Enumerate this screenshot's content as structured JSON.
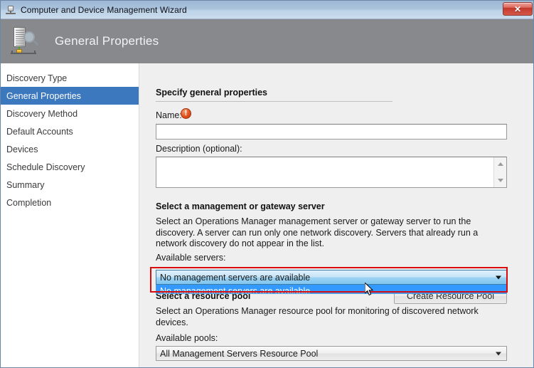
{
  "window": {
    "title": "Computer and Device Management Wizard",
    "title_icon": "device-icon",
    "close_label": "✕"
  },
  "header": {
    "title": "General Properties",
    "icon": "network-discovery-icon"
  },
  "sidebar": {
    "items": [
      {
        "label": "Discovery Type",
        "selected": false
      },
      {
        "label": "General Properties",
        "selected": true
      },
      {
        "label": "Discovery Method",
        "selected": false
      },
      {
        "label": "Default Accounts",
        "selected": false
      },
      {
        "label": "Devices",
        "selected": false
      },
      {
        "label": "Schedule Discovery",
        "selected": false
      },
      {
        "label": "Summary",
        "selected": false
      },
      {
        "label": "Completion",
        "selected": false
      }
    ]
  },
  "main": {
    "general_section": {
      "title": "Specify general properties",
      "name_label": "Name:",
      "name_warning_icon": "error-exclamation-icon",
      "name_warning_glyph": "!",
      "name_value": "",
      "name_placeholder": "",
      "description_label": "Description (optional):",
      "description_value": "",
      "description_placeholder": "",
      "scrollbar_up_icon": "scroll-up-arrow-icon",
      "scrollbar_down_icon": "scroll-down-arrow-icon"
    },
    "management_section": {
      "title": "Select a management or gateway server",
      "description": "Select an Operations Manager management server or gateway server to run the discovery. A server can run only one network discovery. Servers that already run a network discovery do not appear in the list.",
      "available_servers_label": "Available servers:",
      "selected_server": "No management servers are available",
      "dropdown_open": true,
      "dropdown_options": [
        "No management servers are available"
      ],
      "dropdown_arrow_icon": "chevron-down-icon",
      "highlight_color": "#d80c0c"
    },
    "resource_pool_section": {
      "title": "Select a resource pool",
      "description": "Select an Operations Manager resource pool for monitoring of discovered network devices.",
      "create_pool_label": "Create Resource Pool",
      "available_pools_label": "Available pools:",
      "selected_pool": "All Management Servers Resource Pool",
      "dropdown_arrow_icon": "chevron-down-icon"
    }
  },
  "cursor": {
    "icon": "arrow-cursor"
  }
}
